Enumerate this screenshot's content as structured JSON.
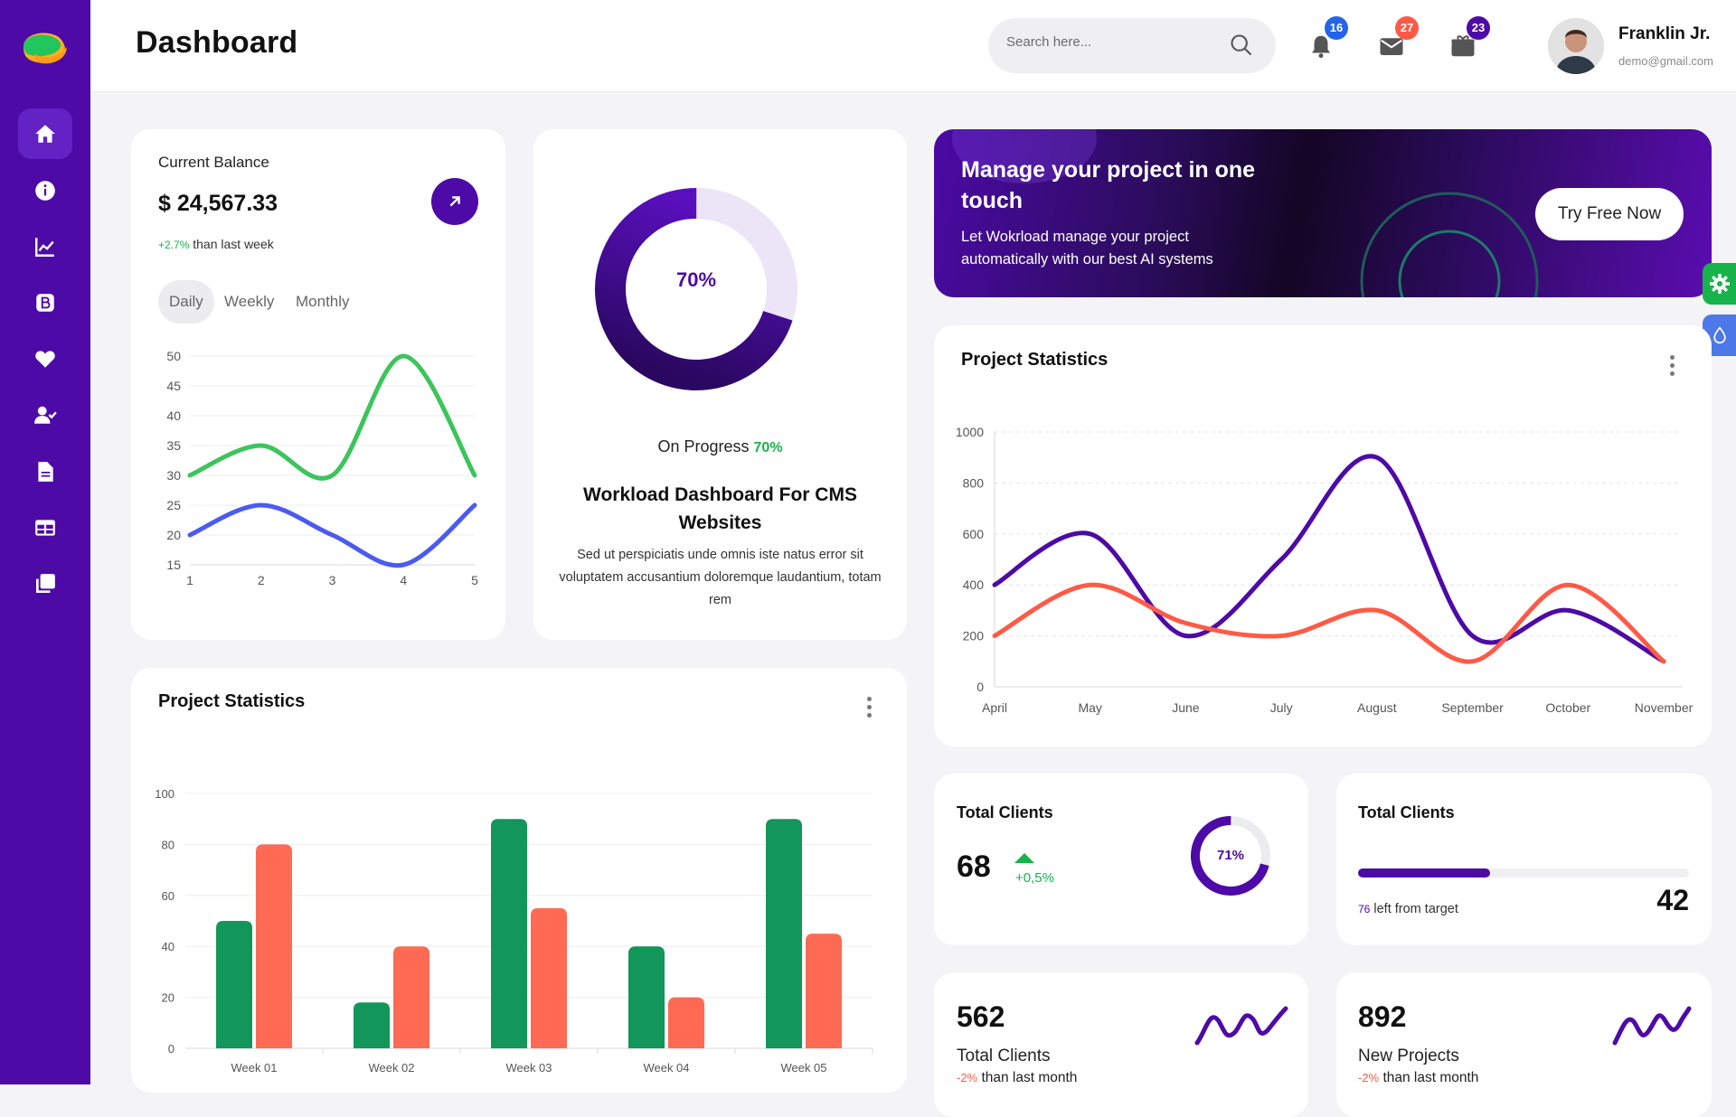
{
  "header": {
    "title": "Dashboard",
    "search_placeholder": "Search here...",
    "notifications": {
      "bell": "16",
      "mail": "27",
      "gift": "23"
    },
    "badge_colors": {
      "bell": "#2563eb",
      "mail": "#ff5a46",
      "gift": "#4d0aa6"
    },
    "user": {
      "name": "Franklin Jr.",
      "email": "demo@gmail.com"
    }
  },
  "sidebar": {
    "items": [
      {
        "icon": "home-icon",
        "active": true
      },
      {
        "icon": "info-icon"
      },
      {
        "icon": "chart-icon"
      },
      {
        "icon": "bootstrap-icon"
      },
      {
        "icon": "heart-icon"
      },
      {
        "icon": "user-check-icon"
      },
      {
        "icon": "document-icon"
      },
      {
        "icon": "grid-icon"
      },
      {
        "icon": "copy-icon"
      }
    ]
  },
  "balance": {
    "label": "Current Balance",
    "amount": "$ 24,567.33",
    "change": "+2.7%",
    "change_text": "than last week",
    "tabs": [
      "Daily",
      "Weekly",
      "Monthly"
    ],
    "active_tab": "Daily"
  },
  "progress_card": {
    "percent_label": "70%",
    "percent": 70,
    "status_label": "On Progress",
    "status_value": "70%",
    "title": "Workload Dashboard For CMS Websites",
    "description": "Sed ut perspiciatis unde omnis iste natus error sit voluptatem accusantium doloremque laudantium, totam rem"
  },
  "banner": {
    "title": "Manage your project in one touch",
    "text": "Let Wokrload manage your project automatically with our best AI systems",
    "button": "Try Free Now"
  },
  "project_stats_line": {
    "title": "Project Statistics"
  },
  "project_stats_bar": {
    "title": "Project Statistics"
  },
  "total_clients_1": {
    "label": "Total Clients",
    "value": "68",
    "change": "+0,5%",
    "donut_label": "71%",
    "donut_percent": 71
  },
  "total_clients_2": {
    "label": "Total Clients",
    "progress_percent": 40,
    "left_value": "76",
    "left_text": "left from target",
    "value": "42"
  },
  "stat_small_1": {
    "value": "562",
    "label": "Total Clients",
    "change": "-2%",
    "change_text": "than last month"
  },
  "stat_small_2": {
    "value": "892",
    "label": "New Projects",
    "change": "-2%",
    "change_text": "than last month"
  },
  "colors": {
    "primary": "#4d0aa6",
    "green": "#16b34a",
    "red": "#ff5a46",
    "blue": "#4b5bf0",
    "bar_green": "#12965a",
    "bar_red": "#ff6a55",
    "float_green": "#16b34a",
    "float_blue": "#4c78e8"
  },
  "chart_data": [
    {
      "type": "line",
      "x": [
        1,
        2,
        3,
        4,
        5
      ],
      "ylim": [
        15,
        50
      ],
      "yticks": [
        15,
        20,
        25,
        30,
        35,
        40,
        45,
        50
      ],
      "series": [
        {
          "color": "#3dc45c",
          "values": [
            30,
            35,
            30,
            50,
            30
          ]
        },
        {
          "color": "#4b5bf0",
          "values": [
            20,
            25,
            20,
            15,
            25
          ]
        }
      ]
    },
    {
      "type": "line",
      "categories": [
        "April",
        "May",
        "June",
        "July",
        "August",
        "September",
        "October",
        "November"
      ],
      "ylim": [
        0,
        1000
      ],
      "yticks": [
        0,
        200,
        400,
        600,
        800,
        1000
      ],
      "series": [
        {
          "color": "#4d0aa6",
          "values": [
            400,
            600,
            200,
            500,
            900,
            200,
            300,
            100
          ]
        },
        {
          "color": "#ff5a46",
          "values": [
            200,
            400,
            250,
            200,
            300,
            100,
            400,
            100
          ]
        }
      ]
    },
    {
      "type": "bar",
      "categories": [
        "Week 01",
        "Week 02",
        "Week 03",
        "Week 04",
        "Week 05"
      ],
      "ylim": [
        0,
        100
      ],
      "yticks": [
        0,
        20,
        40,
        60,
        80,
        100
      ],
      "series": [
        {
          "color": "#12965a",
          "values": [
            50,
            18,
            90,
            40,
            90
          ]
        },
        {
          "color": "#ff6a55",
          "values": [
            80,
            40,
            55,
            20,
            45
          ]
        }
      ]
    }
  ]
}
